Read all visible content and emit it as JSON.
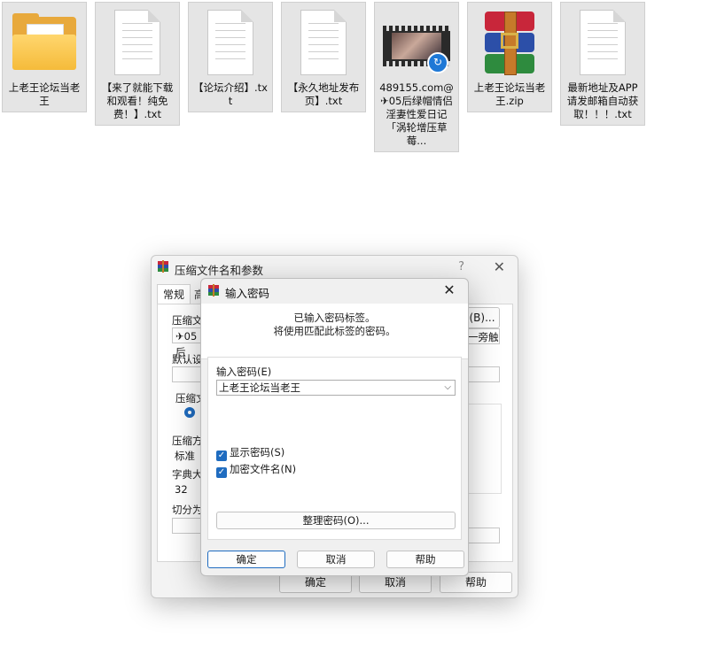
{
  "desktop_files": [
    {
      "name": "上老王论坛当老王",
      "type": "folder"
    },
    {
      "name": "【来了就能下载和观看！纯免费！】.txt",
      "type": "text"
    },
    {
      "name": "【论坛介绍】.txt",
      "type": "text"
    },
    {
      "name": "【永久地址发布页】.txt",
      "type": "text"
    },
    {
      "name": "489155.com@✈05后绿帽情侣淫妻性爱日记「涡轮增压草莓...",
      "type": "video"
    },
    {
      "name": "上老王论坛当老王.zip",
      "type": "archive"
    },
    {
      "name": "最新地址及APP请发邮箱自动获取！！！.txt",
      "type": "text"
    }
  ],
  "back_dialog": {
    "title": "压缩文件名和参数",
    "help_glyph": "?",
    "close_glyph": "✕",
    "tab_general": "常规",
    "tab_cut": "高",
    "archive_name_label": "压缩文",
    "archive_name_value": "✈05后",
    "browse_button": "(B)...",
    "update_mode_value": "一旁触",
    "profile_label": "默认设置",
    "format_label": "压缩文",
    "method_label": "压缩方",
    "method_value": "标准",
    "dict_label": "字典大小",
    "dict_value": "32",
    "split_label": "切分为分",
    "ok_button": "确定",
    "cancel_button": "取消",
    "help_button": "帮助"
  },
  "dialog": {
    "title": "输入密码",
    "close_glyph": "✕",
    "message_line1": "已输入密码标签。",
    "message_line2": "将使用匹配此标签的密码。",
    "password_label": "输入密码(E)",
    "password_value": "上老王论坛当老王",
    "show_password_label": "显示密码(S)",
    "encrypt_names_label": "加密文件名(N)",
    "organize_button": "整理密码(O)...",
    "ok_button": "确定",
    "cancel_button": "取消",
    "help_button": "帮助"
  }
}
